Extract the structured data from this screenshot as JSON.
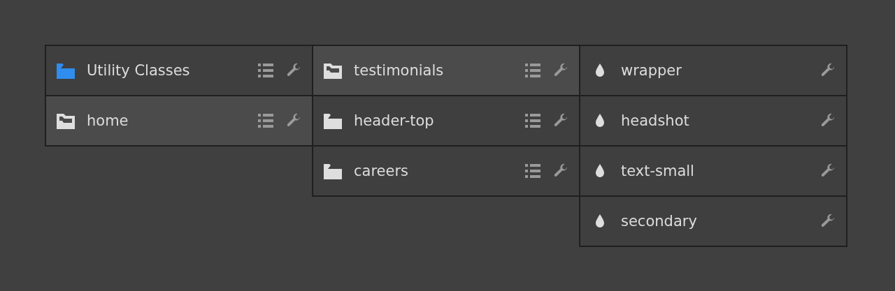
{
  "columns": [
    {
      "items": [
        {
          "label": "Utility Classes",
          "kind": "utility-folder",
          "selected": false
        },
        {
          "label": "home",
          "kind": "folder",
          "selected": true
        }
      ]
    },
    {
      "items": [
        {
          "label": "testimonials",
          "kind": "folder",
          "selected": true
        },
        {
          "label": "header-top",
          "kind": "folder",
          "selected": false
        },
        {
          "label": "careers",
          "kind": "folder",
          "selected": false
        }
      ]
    },
    {
      "items": [
        {
          "label": "wrapper",
          "kind": "class",
          "selected": false
        },
        {
          "label": "headshot",
          "kind": "class",
          "selected": false
        },
        {
          "label": "text-small",
          "kind": "class",
          "selected": false
        },
        {
          "label": "secondary",
          "kind": "class",
          "selected": false
        }
      ]
    }
  ]
}
